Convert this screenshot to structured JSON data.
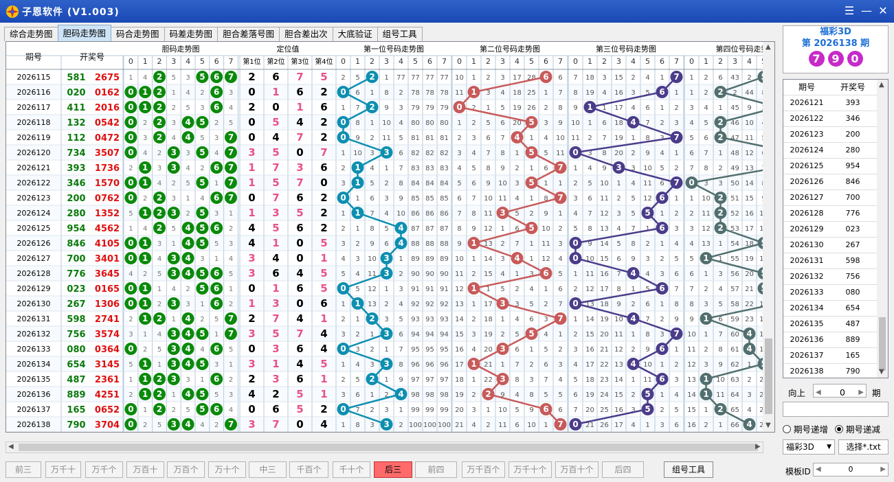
{
  "title": "子恩软件 (V1.003)",
  "tabs": [
    "综合走势图",
    "胆码走势图",
    "码合走势图",
    "码差走势图",
    "胆合差落号图",
    "胆合差出次",
    "大底验证",
    "组号工具"
  ],
  "selected_tab": 1,
  "column_groups": {
    "issue": "期号",
    "prize": "开奖号",
    "dan": "胆码走势图",
    "pos": "定位值",
    "g1": "第一位号码走势图",
    "g2": "第二位号码走势图",
    "g3": "第三位号码走势图",
    "g4": "第四位号码走势"
  },
  "pos_headers": [
    "第1位",
    "第2位",
    "第3位",
    "第4位"
  ],
  "digit_headers": [
    "0",
    "1",
    "2",
    "3",
    "4",
    "5",
    "6",
    "7"
  ],
  "rows": [
    {
      "issue": "2026115",
      "num": "581",
      "prize": "2675",
      "dan": "1123156 7",
      "pos": "2 6 7 5",
      "g1": "2 5 2 1 77 77 77 77",
      "g2": "10 1 2 3 17 28 6 6",
      "g3": "7 18 3 15 2 4 1 7",
      "g4": "1 2 6 43 2 1 1 1"
    },
    {
      "issue": "2026116",
      "num": "020",
      "prize": "0162",
      "dan": "",
      "pos": "0 1 6 2",
      "g1": "0 6 1 8 2 78 78 78",
      "g2": "11 1 3 4 18 25 1 7",
      "g3": "8 19 4 16 3 5 6 1",
      "g4": "1 2 3 2 44 8 2 1"
    },
    {
      "issue": "2026117",
      "num": "411",
      "prize": "2016",
      "dan": "",
      "pos": "2 0 1 6",
      "g1": "1 7 2 9 3 79 79 79",
      "g2": "0 2 1 5 19 26 2 8",
      "g3": "9 1 1 17 4 6 1 2",
      "g4": "3 4 1 45 9 3 1 2"
    },
    {
      "issue": "2026118",
      "num": "132",
      "prize": "0542",
      "dan": "",
      "pos": "0 5 4 2",
      "g1": "0 8 1 10 4 80 80 80",
      "g2": "1 2 5 6 20 5 3 9",
      "g3": "10 1 6 18 4 7 2 3",
      "g4": "4 5 2 46 10 4 2 3"
    },
    {
      "issue": "2026119",
      "num": "112",
      "prize": "0472",
      "dan": "",
      "pos": "0 4 7 2",
      "g1": "0 9 2 11 5 81 81 81",
      "g2": "2 3 6 7 4 1 4 10",
      "g3": "11 2 7 19 1 8 3 7",
      "g4": "5 6 2 47 11 5 3 4"
    },
    {
      "issue": "2026120",
      "num": "734",
      "prize": "3507",
      "dan": "",
      "pos": "3 5 0 7",
      "g1": "1 10 3 3 6 82 82 82",
      "g2": "3 4 7 8 1 5 5 11",
      "g3": "0 3 8 20 2 9 4 1",
      "g4": "6 7 1 48 12 6 4 5"
    },
    {
      "issue": "2026121",
      "num": "393",
      "prize": "1736",
      "dan": "",
      "pos": "1 7 3 6",
      "g1": "2 1 4 1 7 83 83 83",
      "g2": "4 5 8 9 2 1 6 7",
      "g3": "1 4 9 3 3 10 5 2",
      "g4": "7 8 2 49 13 7 5 6"
    },
    {
      "issue": "2026122",
      "num": "346",
      "prize": "1570",
      "dan": "",
      "pos": "1 5 7 0",
      "g1": "3 1 5 2 8 84 84 84",
      "g2": "5 6 9 10 3 5 1 1",
      "g3": "2 5 10 1 4 11 6 7",
      "g4": "0 3 3 50 14 8 6 7"
    },
    {
      "issue": "2026123",
      "num": "200",
      "prize": "0762",
      "dan": "",
      "pos": "0 7 6 2",
      "g1": "0 1 6 3 9 85 85 85",
      "g2": "6 7 10 11 4 1 8 7",
      "g3": "3 6 11 2 5 12 6 1",
      "g4": "1 10 2 51 15 9 7 8"
    },
    {
      "issue": "2026124",
      "num": "280",
      "prize": "1352",
      "dan": "",
      "pos": "1 3 5 2",
      "g1": "1 1 7 4 10 86 86 86",
      "g2": "7 8 11 3 5 2 9 1",
      "g3": "4 7 12 3 5 13 1 2",
      "g4": "2 11 2 52 16 10 8 9"
    },
    {
      "issue": "2026125",
      "num": "954",
      "prize": "4562",
      "dan": "",
      "pos": "4 5 6 2",
      "g1": "2 1 8 5 4 87 87 87",
      "g2": "8 9 12 1 6 5 10 2",
      "g3": "5 8 13 4 7 1 6 3",
      "g4": "3 12 2 53 17 11 9 10"
    },
    {
      "issue": "2026126",
      "num": "846",
      "prize": "4105",
      "dan": "",
      "pos": "4 1 0 5",
      "g1": "3 2 9 6 4 88 88 88",
      "g2": "9 1 13 2 7 1 11 3",
      "g3": "0 9 14 5 8 2 1 4",
      "g4": "4 13 1 54 18 12 10 11"
    },
    {
      "issue": "2026127",
      "num": "700",
      "prize": "3401",
      "dan": "",
      "pos": "3 4 0 1",
      "g1": "4 3 10 3 1 89 89 89",
      "g2": "10 1 14 3 4 1 12 4",
      "g3": "0 10 15 6 9 3 2 5",
      "g4": "5 1 1 55 19 13 11 12"
    },
    {
      "issue": "2026128",
      "num": "776",
      "prize": "3645",
      "dan": "",
      "pos": "3 6 4 5",
      "g1": "5 4 11 3 2 90 90 90",
      "g2": "11 2 15 4 1 3 6 5",
      "g3": "1 11 16 7 4 4 3 6",
      "g4": "6 1 3 56 20 14 12 13"
    },
    {
      "issue": "2026129",
      "num": "023",
      "prize": "0165",
      "dan": "",
      "pos": "0 1 6 5",
      "g1": "0 5 12 1 3 91 91 91",
      "g2": "12 1 1 5 2 4 1 6",
      "g3": "2 12 17 8 1 5 6 7",
      "g4": "7 2 4 57 21 15 13 14"
    },
    {
      "issue": "2026130",
      "num": "267",
      "prize": "1306",
      "dan": "",
      "pos": "1 3 0 6",
      "g1": "1 1 13 2 4 92 92 92",
      "g2": "13 1 17 3 3 5 2 7",
      "g3": "0 13 18 9 2 6 1 8",
      "g4": "8 3 5 58 22 16 14 15"
    },
    {
      "issue": "2026131",
      "num": "598",
      "prize": "2741",
      "dan": "",
      "pos": "2 7 4 1",
      "g1": "2 1 2 3 5 93 93 93",
      "g2": "14 2 18 1 4 6 3 7",
      "g3": "1 14 19 10 4 7 2 9",
      "g4": "9 1 6 59 23 17 15 16"
    },
    {
      "issue": "2026132",
      "num": "756",
      "prize": "3574",
      "dan": "",
      "pos": "3 5 7 4",
      "g1": "3 2 1 3 6 94 94 94",
      "g2": "15 3 19 2 5 5 4 1",
      "g3": "2 15 20 11 1 8 3 7",
      "g4": "10 1 7 60 4 18 16 17"
    },
    {
      "issue": "2026133",
      "num": "080",
      "prize": "0364",
      "dan": "",
      "pos": "0 3 6 4",
      "g1": "0 3 2 1 7 95 95 95",
      "g2": "16 4 20 3 6 1 5 2",
      "g3": "3 16 21 12 2 9 6 1",
      "g4": "11 2 8 61 4 19 17 18"
    },
    {
      "issue": "2026134",
      "num": "654",
      "prize": "3145",
      "dan": "",
      "pos": "3 1 4 5",
      "g1": "1 4 3 3 8 96 96 96",
      "g2": "17 1 21 1 7 2 6 3",
      "g3": "4 17 22 13 4 10 1 2",
      "g4": "12 3 9 62 1 20 18 19"
    },
    {
      "issue": "2026135",
      "num": "487",
      "prize": "2361",
      "dan": "",
      "pos": "2 3 6 1",
      "g1": "2 5 2 1 9 97 97 97",
      "g2": "18 1 22 3 8 3 7 4",
      "g3": "5 18 23 14 1 11 6 3",
      "g4": "13 1 10 63 2 21 19 20"
    },
    {
      "issue": "2026136",
      "num": "889",
      "prize": "4251",
      "dan": "",
      "pos": "4 2 5 1",
      "g1": "3 6 1 2 4 98 98 98",
      "g2": "19 2 1 9 4 8 5 5",
      "g3": "6 19 24 15 2 5 1 4",
      "g4": "14 1 11 64 3 22 20 21"
    },
    {
      "issue": "2026137",
      "num": "165",
      "prize": "0652",
      "dan": "",
      "pos": "0 6 5 2",
      "g1": "0 7 2 3 1 99 99 99",
      "g2": "20 3 1 10 5 9 6 6",
      "g3": "7 20 25 16 3 5 2 5",
      "g4": "15 1 2 65 4 23 21 22"
    },
    {
      "issue": "2026138",
      "num": "790",
      "prize": "3704",
      "dan": "",
      "pos": "3 7 0 4",
      "g1": "1 8 3 3 2 100 100 100",
      "g2": "21 4 2 11 6 10 1 7",
      "g3": "0 21 26 17 4 1 3 6",
      "g4": "16 2 1 66 4 24 22 23"
    }
  ],
  "colors": {
    "g1": "#0d8fb0",
    "g2": "#c85a5a",
    "g3": "#4b3c8a",
    "g4": "#526f6f",
    "dan": "#0a8a0a",
    "num": "#0a7a0a",
    "prize": "#e01010",
    "pos_odd": "#e8508a",
    "pos_even": "#000000"
  },
  "lottery": {
    "name": "福彩3D",
    "issue_label": "第 2026138 期",
    "balls": [
      "7",
      "9",
      "0"
    ]
  },
  "history": {
    "headers": [
      "期号",
      "开奖号"
    ],
    "rows": [
      [
        "2026121",
        "393"
      ],
      [
        "2026122",
        "346"
      ],
      [
        "2026123",
        "200"
      ],
      [
        "2026124",
        "280"
      ],
      [
        "2026125",
        "954"
      ],
      [
        "2026126",
        "846"
      ],
      [
        "2026127",
        "700"
      ],
      [
        "2026128",
        "776"
      ],
      [
        "2026129",
        "023"
      ],
      [
        "2026130",
        "267"
      ],
      [
        "2026131",
        "598"
      ],
      [
        "2026132",
        "756"
      ],
      [
        "2026133",
        "080"
      ],
      [
        "2026134",
        "654"
      ],
      [
        "2026135",
        "487"
      ],
      [
        "2026136",
        "889"
      ],
      [
        "2026137",
        "165"
      ],
      [
        "2026138",
        "790"
      ]
    ]
  },
  "dir": {
    "up": "向上",
    "value": "0",
    "unit": "期"
  },
  "radios": [
    {
      "label": "期号递增",
      "checked": false
    },
    {
      "label": "期号递减",
      "checked": true
    }
  ],
  "combo": "福彩3D",
  "choose_file": "选择*.txt",
  "template": {
    "label": "模板ID",
    "value": "0"
  },
  "bottom_buttons": [
    "前三",
    "万千十",
    "万千个",
    "万百十",
    "万百个",
    "万十个",
    "中三",
    "千百个",
    "千十个",
    "后三",
    "前四",
    "万千百个",
    "万千十个",
    "万百十个",
    "后四"
  ],
  "active_bottom": "后三",
  "group_tool": "组号工具"
}
